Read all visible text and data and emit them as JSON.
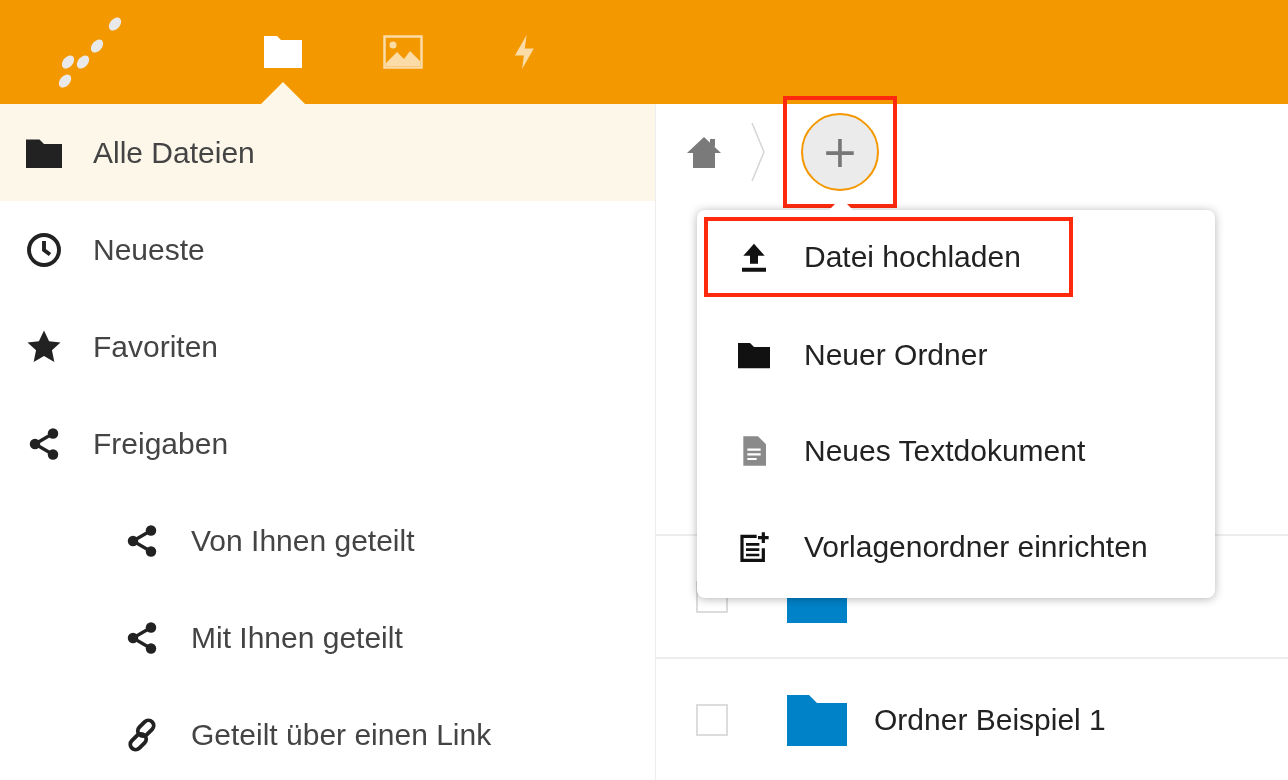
{
  "app_tabs": [
    {
      "kind": "files",
      "selected": true
    },
    {
      "kind": "photos",
      "selected": false
    },
    {
      "kind": "activity",
      "selected": false
    }
  ],
  "sidebar": {
    "items": [
      {
        "kind": "folder",
        "label": "Alle Dateien",
        "selected": true
      },
      {
        "kind": "clock",
        "label": "Neueste",
        "selected": false
      },
      {
        "kind": "star",
        "label": "Favoriten",
        "selected": false
      },
      {
        "kind": "share",
        "label": "Freigaben",
        "selected": false,
        "children": [
          {
            "kind": "share",
            "label": "Von Ihnen geteilt",
            "selected": false
          },
          {
            "kind": "share",
            "label": "Mit Ihnen geteilt",
            "selected": false
          },
          {
            "kind": "link",
            "label": "Geteilt über einen Link",
            "selected": false
          }
        ]
      }
    ]
  },
  "breadcrumb": {
    "add_button": {
      "label": "+",
      "highlighted": true
    }
  },
  "new_menu": {
    "items": [
      {
        "kind": "upload",
        "label": "Datei hochladen",
        "highlighted": true
      },
      {
        "kind": "folder",
        "label": "Neuer Ordner",
        "highlighted": false
      },
      {
        "kind": "text",
        "label": "Neues Textdokument",
        "highlighted": false
      },
      {
        "kind": "template",
        "label": "Vorlagenordner einrichten",
        "highlighted": false
      }
    ]
  },
  "files": [
    {
      "checked": false
    },
    {
      "name": "Ordner Beispiel 1",
      "checked": false
    }
  ]
}
